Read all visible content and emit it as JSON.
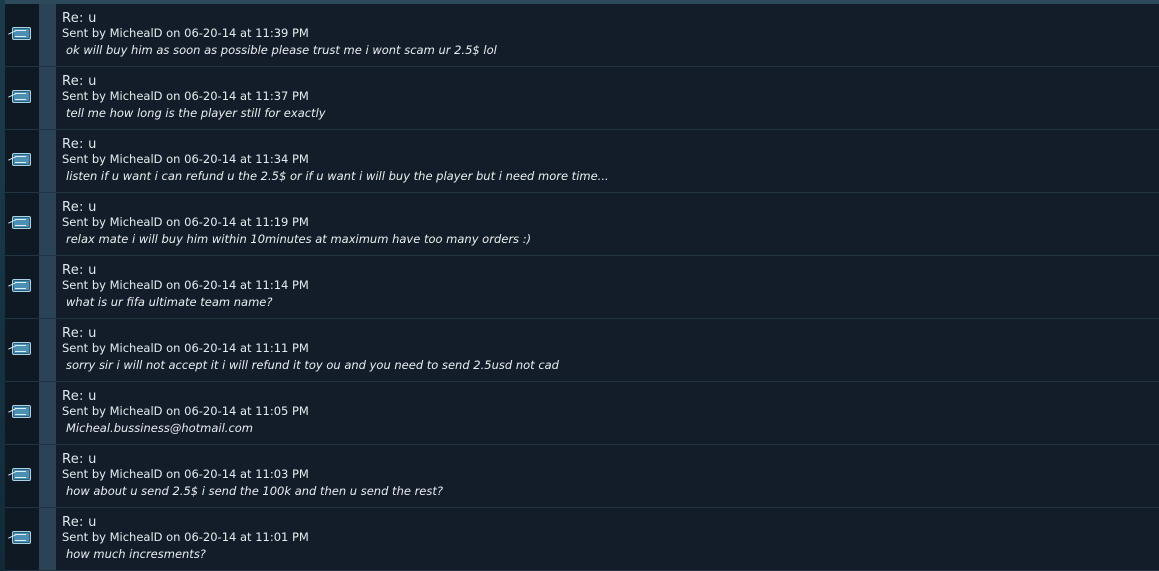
{
  "messages": [
    {
      "subject": "Re: u",
      "meta": "Sent by MichealD on 06-20-14 at 11:39 PM",
      "body": "ok will buy him as soon as possible please trust me i wont scam ur 2.5$ lol"
    },
    {
      "subject": "Re: u",
      "meta": "Sent by MichealD on 06-20-14 at 11:37 PM",
      "body": "tell me how long is the player still for exactly"
    },
    {
      "subject": "Re: u",
      "meta": "Sent by MichealD on 06-20-14 at 11:34 PM",
      "body": "listen if u want i can refund u the 2.5$ or if u want i will buy the player but i need more time..."
    },
    {
      "subject": "Re: u",
      "meta": "Sent by MichealD on 06-20-14 at 11:19 PM",
      "body": "relax mate i will buy him within 10minutes at maximum have too many orders :)"
    },
    {
      "subject": "Re: u",
      "meta": "Sent by MichealD on 06-20-14 at 11:14 PM",
      "body": "what is ur fifa ultimate team name?"
    },
    {
      "subject": "Re: u",
      "meta": "Sent by MichealD on 06-20-14 at 11:11 PM",
      "body": "sorry sir i will not accept it i will refund it toy ou and you need to send 2.5usd not cad"
    },
    {
      "subject": "Re: u",
      "meta": "Sent by MichealD on 06-20-14 at 11:05 PM",
      "body": "Micheal.bussiness@hotmail.com"
    },
    {
      "subject": "Re: u",
      "meta": "Sent by MichealD on 06-20-14 at 11:03 PM",
      "body": "how about u send 2.5$ i send the 100k and then u send the rest?"
    },
    {
      "subject": "Re: u",
      "meta": "Sent by MichealD on 06-20-14 at 11:01 PM",
      "body": "how much incresments?"
    }
  ]
}
